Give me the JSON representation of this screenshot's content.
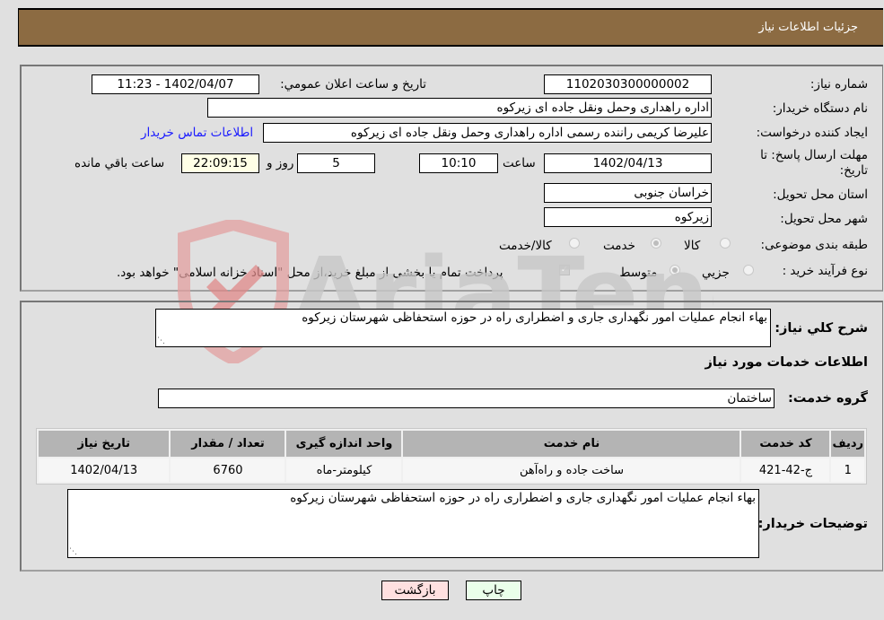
{
  "header": {
    "title": "جزئیات اطلاعات نیاز"
  },
  "form": {
    "need_number": {
      "label": "شماره نیاز:",
      "value": "1102030300000002"
    },
    "announce_datetime": {
      "label": "تاریخ و ساعت اعلان عمومي:",
      "value": "1402/04/07 - 11:23"
    },
    "buyer_org": {
      "label": "نام دستگاه خریدار:",
      "value": "اداره راهداری وحمل ونقل جاده ای زیرکوه"
    },
    "requester": {
      "label": "ایجاد کننده درخواست:",
      "value": "علیرضا کریمی راننده رسمی اداره راهداری وحمل ونقل جاده ای زیرکوه"
    },
    "buyer_contact_link": "اطلاعات تماس خریدار",
    "deadline": {
      "label_line1": "مهلت ارسال پاسخ: تا",
      "label_line2": "تاریخ:",
      "date": "1402/04/13",
      "time_label": "ساعت",
      "time": "10:10",
      "days": "5",
      "days_label": "روز و",
      "remaining": "22:09:15",
      "remaining_label": "ساعت باقي مانده"
    },
    "province": {
      "label": "استان محل تحویل:",
      "value": "خراسان جنوبی"
    },
    "city": {
      "label": "شهر محل تحویل:",
      "value": "زیرکوه"
    },
    "category": {
      "label": "طبقه بندی موضوعی:",
      "options": [
        "کالا",
        "خدمت",
        "کالا/خدمت"
      ],
      "selected": "خدمت"
    },
    "purchase_type": {
      "label": "نوع فرآیند خرید :",
      "options": [
        "جزيي",
        "متوسط"
      ],
      "selected": "متوسط",
      "treasury_checkbox_label": "پرداخت تمام یا بخشی از مبلغ خرید،از محل \"اسناد خزانه اسلامی\" خواهد بود.",
      "treasury_checked": true
    }
  },
  "details": {
    "summary_label": "شرح كلي نياز:",
    "summary_value": "بهاء انجام عملیات امور نگهداری جاری و اضطراری راه در حوزه استحفاظی شهرستان زیرکوه",
    "services_heading": "اطلاعات خدمات مورد نياز",
    "service_group_label": "گروه خدمت:",
    "service_group_value": "ساختمان",
    "table": {
      "headers": [
        "رديف",
        "کد خدمت",
        "نام خدمت",
        "واحد اندازه گیری",
        "تعداد / مقدار",
        "تاریخ نیاز"
      ],
      "rows": [
        [
          "1",
          "ج-42-421",
          "ساخت جاده و راه‌آهن",
          "کیلومتر-ماه",
          "6760",
          "1402/04/13"
        ]
      ]
    },
    "buyer_notes_label": "توضیحات خریدار:",
    "buyer_notes_value": "بهاء انجام عملیات امور نگهداری جاری و اضطراری راه در حوزه استحفاظی شهرستان زیرکوه"
  },
  "buttons": {
    "print": "چاپ",
    "back": "بازگشت"
  },
  "watermark": {
    "text": "AriaTender.neT"
  }
}
